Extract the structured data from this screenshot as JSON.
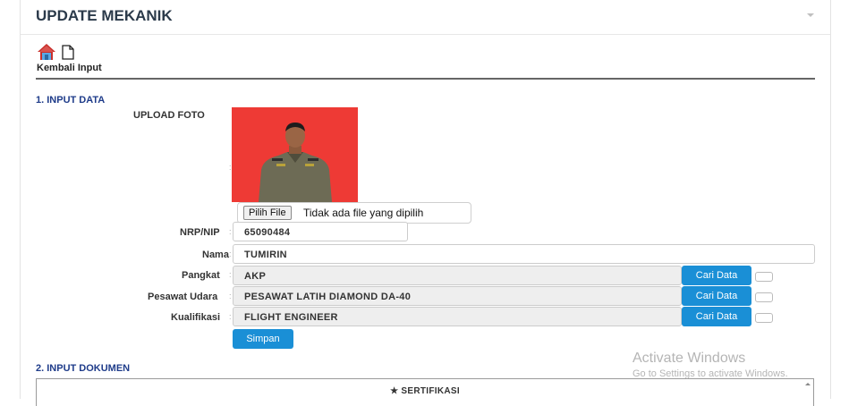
{
  "header": {
    "title": "UPDATE MEKANIK"
  },
  "toolbar": {
    "home_icon": "home-icon",
    "doc_icon": "document-icon",
    "label": "Kembali Input"
  },
  "section1": {
    "title": "1. INPUT DATA",
    "upload_label": "UPLOAD FOTO",
    "file_button": "Pilih File",
    "file_status": "Tidak ada file yang dipilih"
  },
  "fields": {
    "nrp": {
      "label": "NRP/NIP",
      "value": "65090484"
    },
    "nama": {
      "label": "Nama",
      "value": "TUMIRIN"
    },
    "pangkat": {
      "label": "Pangkat",
      "value": "AKP",
      "button": "Cari Data"
    },
    "pesawat": {
      "label": "Pesawat Udara",
      "value": "PESAWAT LATIH DIAMOND DA-40",
      "button": "Cari Data"
    },
    "kualifikasi": {
      "label": "Kualifikasi",
      "value": "FLIGHT ENGINEER",
      "button": "Cari Data"
    }
  },
  "save_button": "Simpan",
  "section2": {
    "title": "2. INPUT DOKUMEN",
    "tab": "★ SERTIFIKASI"
  },
  "watermark": {
    "line1": "Activate Windows",
    "line2": "Go to Settings to activate Windows."
  },
  "colors": {
    "accent": "#1a8fd6",
    "photo_bg": "#ee3a35",
    "section_title": "#1f3c8a"
  }
}
